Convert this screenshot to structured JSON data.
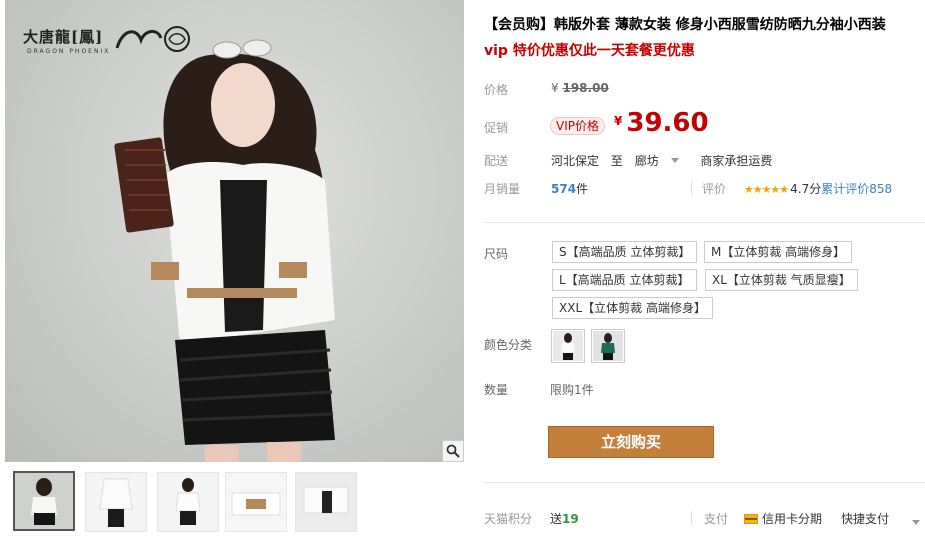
{
  "gallery": {
    "brand_name": "大唐龍[鳳]",
    "brand_sub": "DRAGON   PHOENIX",
    "thumbnail_count": 5
  },
  "product": {
    "title": "【会员购】韩版外套 薄款女装 修身小西服雪纺防晒九分袖小西装",
    "subtitle": "vip 特价优惠仅此一天套餐更优惠"
  },
  "price": {
    "label": "价格",
    "currency": "¥",
    "original": "198.00"
  },
  "promo": {
    "label": "促销",
    "tag": "VIP价格",
    "currency": "¥",
    "price": "39.60"
  },
  "delivery": {
    "label": "配送",
    "from": "河北保定",
    "to_word": "至",
    "to": "廊坊",
    "fee": "商家承担运费"
  },
  "sales": {
    "label": "月销量",
    "count": "574",
    "unit": "件"
  },
  "rating": {
    "label": "评价",
    "stars": "★★★★★",
    "score": "4.7分",
    "count_text": "累计评价858"
  },
  "sku": {
    "size_label": "尺码",
    "sizes": [
      "S【高端品质 立体剪裁】",
      "M【立体剪裁 高端修身】",
      "L【高端品质 立体剪裁】",
      "XL【立体剪裁 气质显瘦】",
      "XXL【立体剪裁 高端修身】"
    ],
    "color_label": "颜色分类",
    "quantity_label": "数量",
    "quantity_limit": "限购1件"
  },
  "buy_button": "立刻购买",
  "footer": {
    "points_label": "天猫积分",
    "points_prefix": "送",
    "points_value": "19",
    "pay_label": "支付",
    "installment": "信用卡分期",
    "quick_pay": "快捷支付"
  },
  "colors": {
    "accent_red": "#c40000",
    "buy_button": "#c47f3d",
    "link_blue": "#3c82c3",
    "star_gold": "#f1a500",
    "points_green": "#2a9a38"
  }
}
